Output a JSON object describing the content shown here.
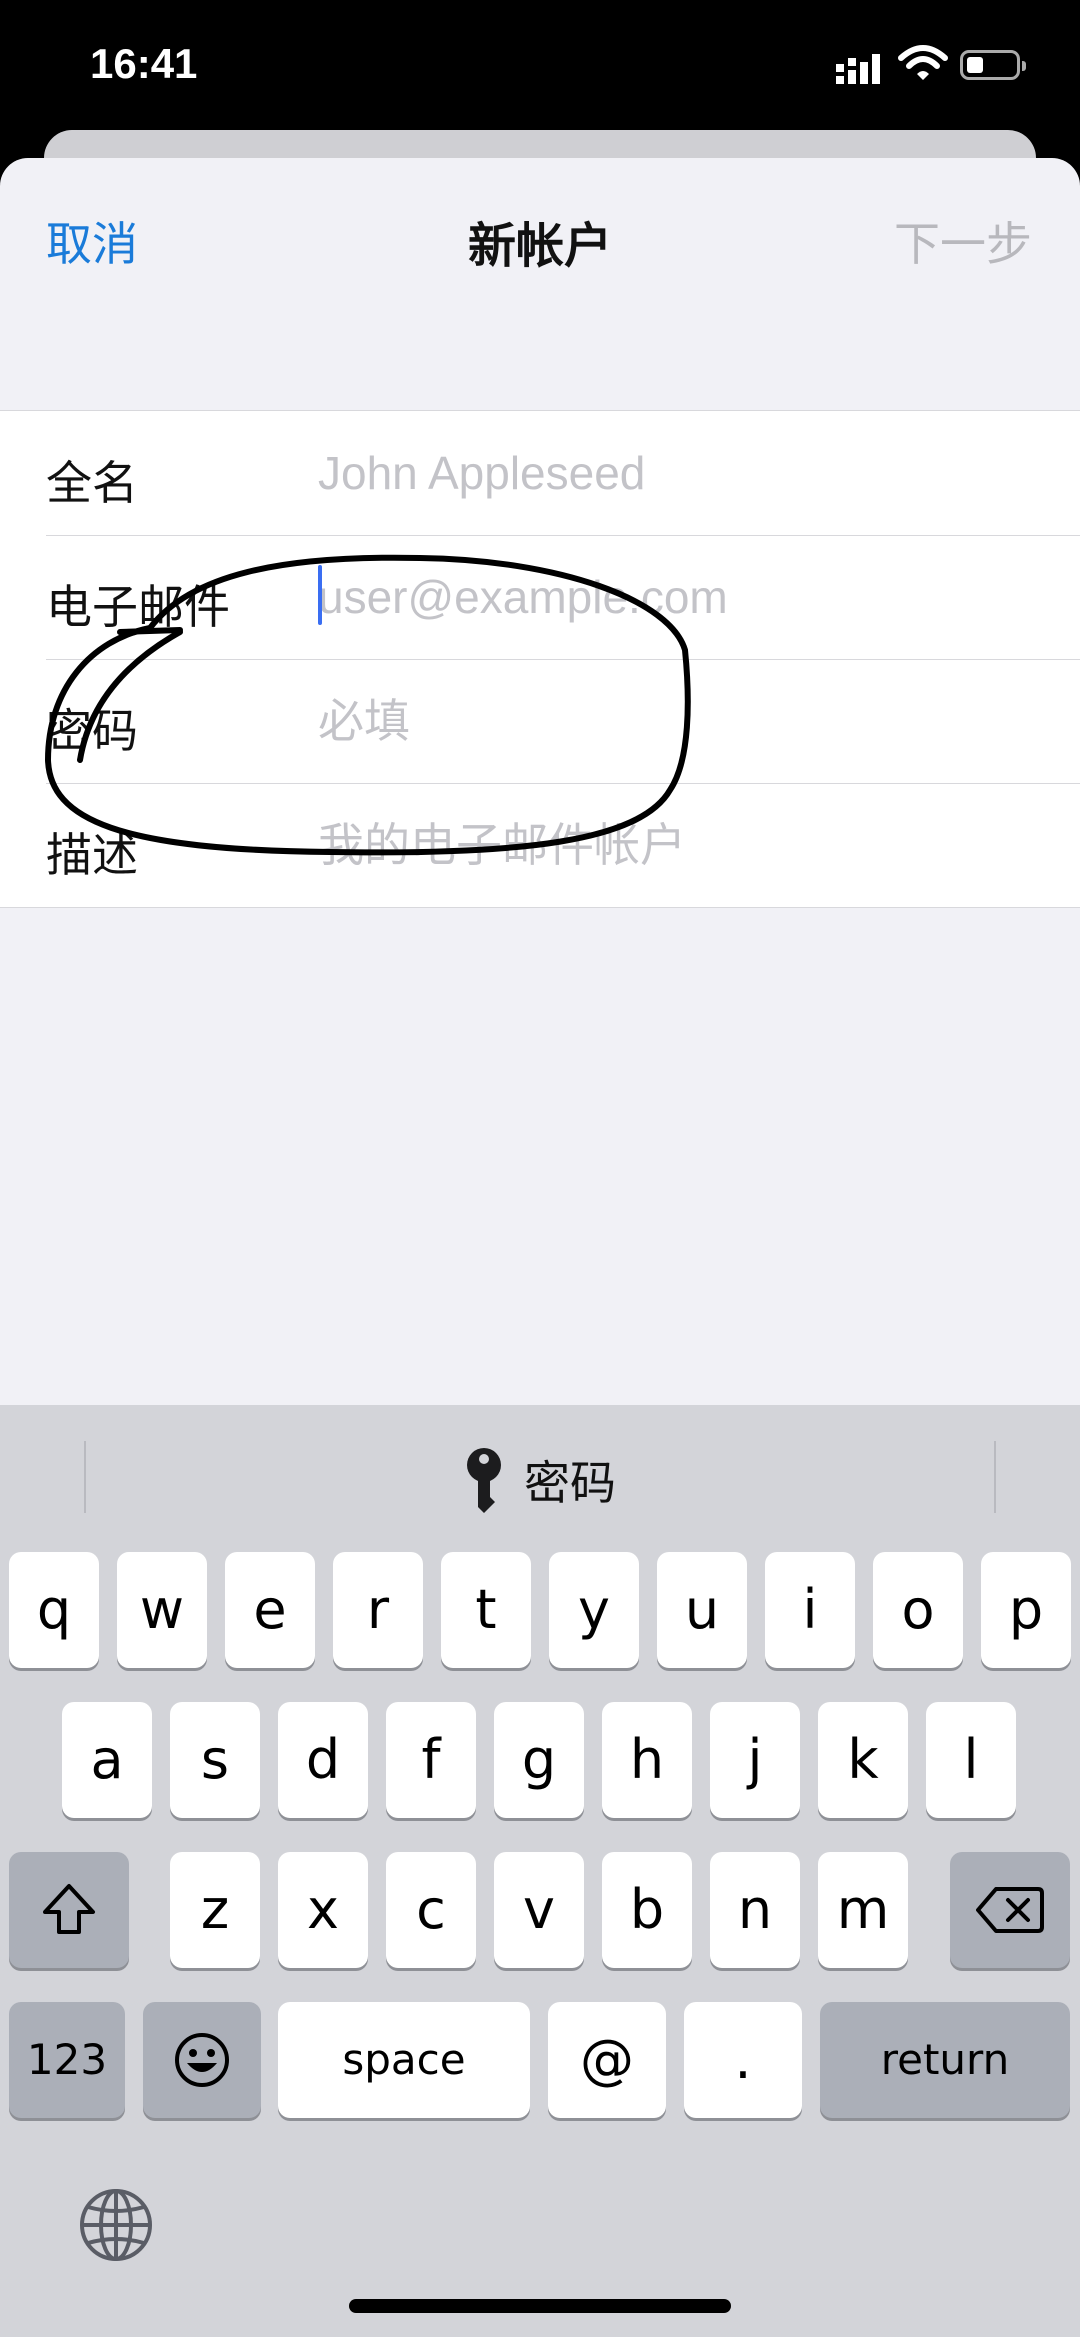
{
  "status": {
    "time": "16:41"
  },
  "nav": {
    "cancel": "取消",
    "title": "新帐户",
    "next": "下一步"
  },
  "form": {
    "rows": [
      {
        "label": "全名",
        "placeholder": "John Appleseed"
      },
      {
        "label": "电子邮件",
        "placeholder": "user@example.com"
      },
      {
        "label": "密码",
        "placeholder": "必填"
      },
      {
        "label": "描述",
        "placeholder": "我的电子邮件帐户"
      }
    ]
  },
  "keyboard": {
    "suggestion": "密码",
    "row1": [
      "q",
      "w",
      "e",
      "r",
      "t",
      "y",
      "u",
      "i",
      "o",
      "p"
    ],
    "row2": [
      "a",
      "s",
      "d",
      "f",
      "g",
      "h",
      "j",
      "k",
      "l"
    ],
    "row3": [
      "z",
      "x",
      "c",
      "v",
      "b",
      "n",
      "m"
    ],
    "numbers": "123",
    "space": "space",
    "at": "@",
    "dot": ".",
    "return": "return"
  },
  "colors": {
    "accent": "#1a7bd9",
    "disabled": "#b8b8bd",
    "caret": "#3a6ef2"
  },
  "icons": [
    "signal-icon",
    "wifi-icon",
    "battery-icon",
    "key-icon",
    "shift-icon",
    "delete-icon",
    "emoji-icon",
    "globe-icon"
  ]
}
